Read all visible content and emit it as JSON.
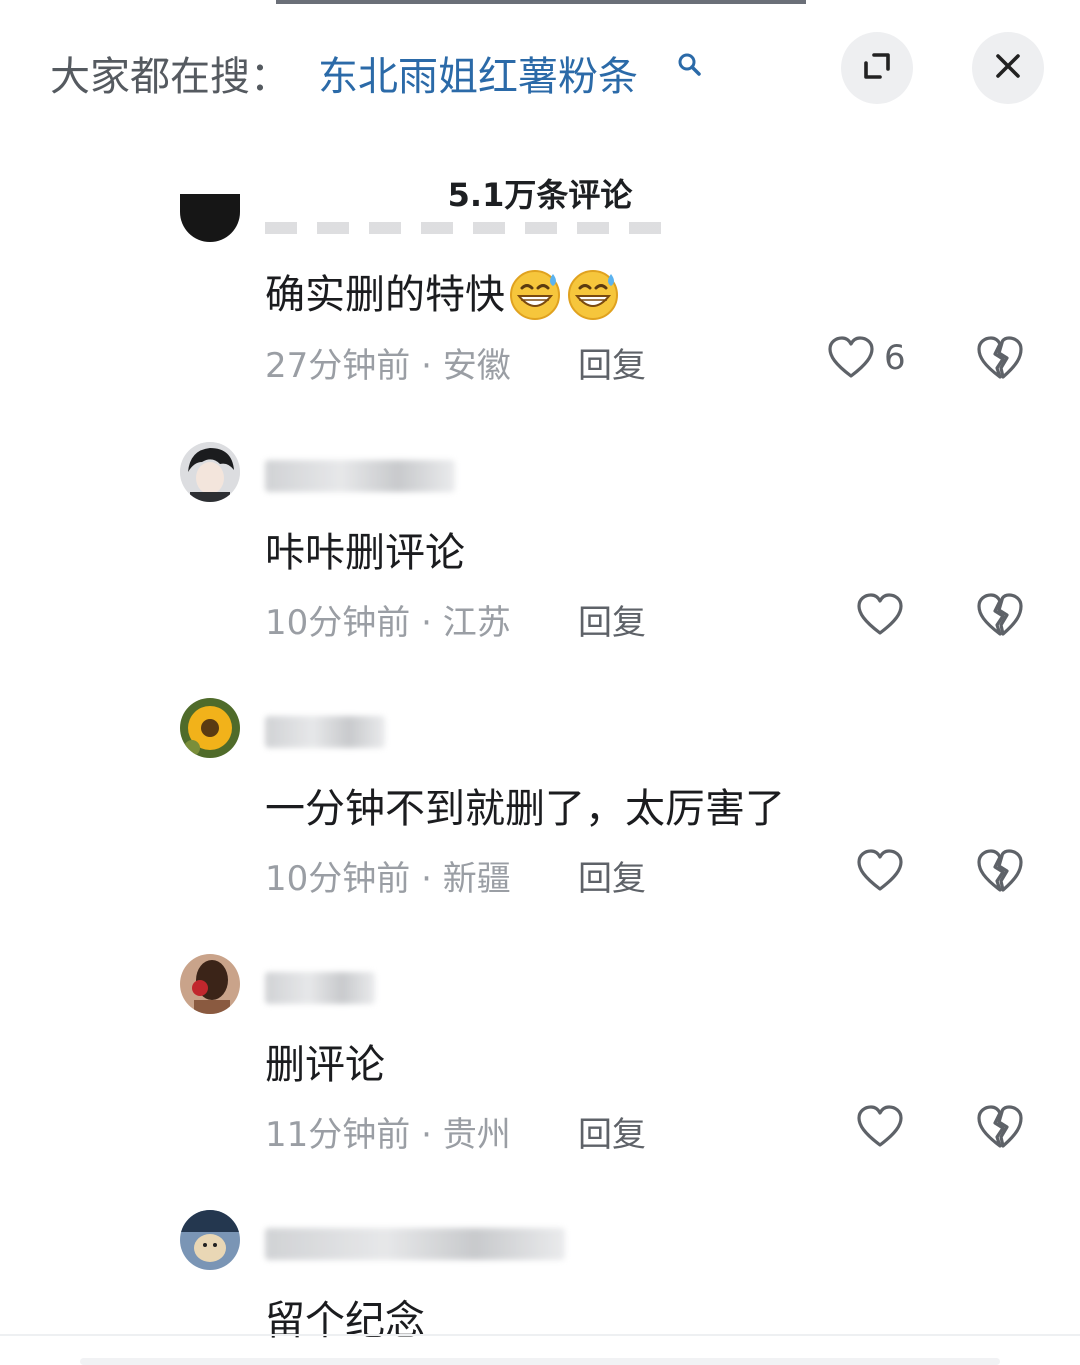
{
  "search": {
    "prefix": "大家都在搜：",
    "term": "东北雨姐红薯粉条"
  },
  "comments_title": "5.1万条评论",
  "comments": [
    {
      "content": "确实删的特快",
      "emoji": [
        "grinning-sweat-emoji",
        "grinning-sweat-emoji"
      ],
      "time": "27分钟前",
      "location": "安徽",
      "reply": "回复",
      "likes": "6"
    },
    {
      "content": "咔咔删评论",
      "time": "10分钟前",
      "location": "江苏",
      "reply": "回复"
    },
    {
      "content": "一分钟不到就删了，太厉害了",
      "time": "10分钟前",
      "location": "新疆",
      "reply": "回复"
    },
    {
      "content": "删评论",
      "time": "11分钟前",
      "location": "贵州",
      "reply": "回复"
    },
    {
      "content": "留个纪念"
    }
  ],
  "colors": {
    "search_term": "#2b6aa8",
    "meta_text": "#9a9ea4",
    "content_text": "#1b1c1f"
  },
  "icons": [
    "search-icon",
    "expand-icon",
    "close-icon",
    "heart-icon",
    "broken-heart-icon"
  ]
}
